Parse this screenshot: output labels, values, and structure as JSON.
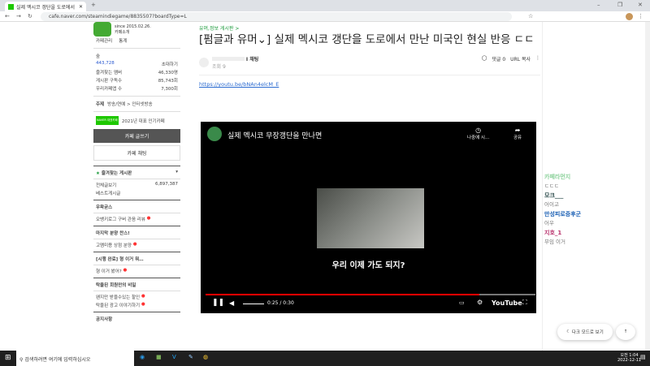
{
  "browser": {
    "tab_title": "실제 멕시코 갱단을 도로에서",
    "url": "cafe.naver.com/steamindiegame/8835507?boardType=L"
  },
  "cafe": {
    "since": "since 2015.02.26.",
    "intro": "카페소개",
    "manage": "카페관리",
    "stats": "통계",
    "level": "숲",
    "members": "443,728",
    "invite": "초대하기",
    "fav_label": "즐겨찾는 멤버",
    "fav_val": "46,330명",
    "sub_label": "게시판 구독수",
    "sub_val": "85,743회",
    "rank_label": "우리카페앱 수",
    "rank_val": "7,300회",
    "topic_label": "주제",
    "topic_val": "방송/연예 > 인터넷방송",
    "award_badge": "NAVER 대표카페",
    "award": "2021년 대표 인기카페",
    "write": "카페 글쓰기",
    "chat": "카페 채팅",
    "fav_boards": "즐겨찾는 게시판",
    "all_posts": "전체글보기",
    "all_count": "6,897,387",
    "best": "베스트게시글",
    "sections": [
      {
        "title": "우왁굳스",
        "items": [
          "오뱅키로그 구버 관음 리뷰"
        ]
      },
      {
        "title": "마지막 분양 찬스!",
        "items": [
          "고멤미용 상점 분양"
        ]
      },
      {
        "title": "[시행 완료] 형 이거 뭐…",
        "items": [
          "형 이거 봤어?"
        ]
      },
      {
        "title": "탁울된 회원만의 비밀",
        "items": [
          "왠지만 받을수있는 할인",
          "탁울된 광고 이야기하기"
        ]
      }
    ],
    "notice": "공지사항"
  },
  "article": {
    "board": "유머,정보 게시판 >",
    "title": "[펌글과 유머⌄] 실제 멕시코 갱단을 도로에서 만난 미국인 현실 반응 ㄷㄷ",
    "author_suffix": "I 채팅",
    "views": "조회 9",
    "comments": "댓글 0",
    "url_copy": "URL 복사",
    "link": "https://youtu.be/bNAn4elcM_E"
  },
  "video": {
    "title": "실제 멕시코 무장갱단을 만나면",
    "watch_later": "나중에 시...",
    "share": "공유",
    "subtitle": "우리 이제 가도 되지?",
    "time": "0:25 / 0:30",
    "progress": 0.83,
    "logo": "YouTube"
  },
  "chat": [
    {
      "name": "카페라먼지",
      "msg": "ㄷㄷㄷ",
      "color": "#8bd19a"
    },
    {
      "name": "모크___",
      "msg": "어이고",
      "color": "#2a4a4a"
    },
    {
      "name": "만성피로증후군",
      "msg": "어우",
      "color": "#1a5fb4"
    },
    {
      "name": "지호_1",
      "msg": "무임 이거",
      "color": "#b8306b"
    }
  ],
  "buttons": {
    "dark_mode": "다크 모드로 보기"
  },
  "taskbar": {
    "search": "검색하려면 여기에 입력하십시오",
    "ampm": "오전 1:04",
    "date": "2022-12-11"
  }
}
